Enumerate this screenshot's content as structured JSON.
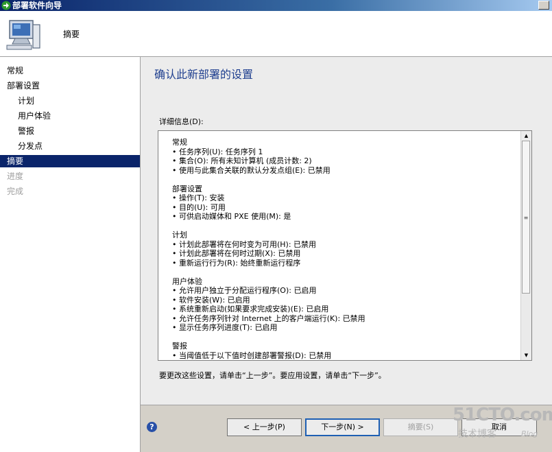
{
  "window": {
    "title": "部署软件向导"
  },
  "header": {
    "title": "摘要"
  },
  "sidebar": {
    "items": [
      {
        "label": "常规",
        "state": "normal"
      },
      {
        "label": "部署设置",
        "state": "normal"
      },
      {
        "label": "计划",
        "state": "normal"
      },
      {
        "label": "用户体验",
        "state": "normal"
      },
      {
        "label": "警报",
        "state": "normal"
      },
      {
        "label": "分发点",
        "state": "normal"
      },
      {
        "label": "摘要",
        "state": "active"
      },
      {
        "label": "进度",
        "state": "disabled"
      },
      {
        "label": "完成",
        "state": "disabled"
      }
    ]
  },
  "main": {
    "heading": "确认此新部署的设置",
    "details_label": "详细信息(D):",
    "sections": [
      {
        "title": "常规",
        "items": [
          "任务序列(U): 任务序列 1",
          "集合(O): 所有未知计算机 (成员计数: 2)",
          "使用与此集合关联的默认分发点组(E): 已禁用"
        ]
      },
      {
        "title": "部署设置",
        "items": [
          "操作(T): 安装",
          "目的(U): 可用",
          "可供启动媒体和 PXE 使用(M): 是"
        ]
      },
      {
        "title": "计划",
        "items": [
          "计划此部署将在何时变为可用(H): 已禁用",
          "计划此部署将在何时过期(X): 已禁用",
          "重新运行行为(R): 始终重新运行程序"
        ]
      },
      {
        "title": "用户体验",
        "items": [
          "允许用户独立于分配运行程序(O): 已启用",
          "软件安装(W): 已启用",
          "系统重新启动(如果要求完成安装)(E): 已启用",
          "允许任务序列针对 Internet 上的客户端运行(K): 已禁用",
          "显示任务序列进度(T): 已启用"
        ]
      },
      {
        "title": "警报",
        "items": [
          "当阈值低于以下值时创建部署警报(D): 已禁用"
        ]
      }
    ],
    "hint": "要更改这些设置，请单击“上一步”。要应用设置，请单击“下一步”。"
  },
  "footer": {
    "prev_label": "< 上一步(P)",
    "next_label": "下一步(N) >",
    "summary_label": "摘要(S)",
    "cancel_label": "取消"
  },
  "watermark": {
    "main": "51CTO.com",
    "sub": "技术博客",
    "blog": "Blog"
  },
  "colors": {
    "titlebar": "#0a246a",
    "active_nav": "#0a246a",
    "heading": "#1f3f8f",
    "disabled": "#a0a0a0"
  }
}
